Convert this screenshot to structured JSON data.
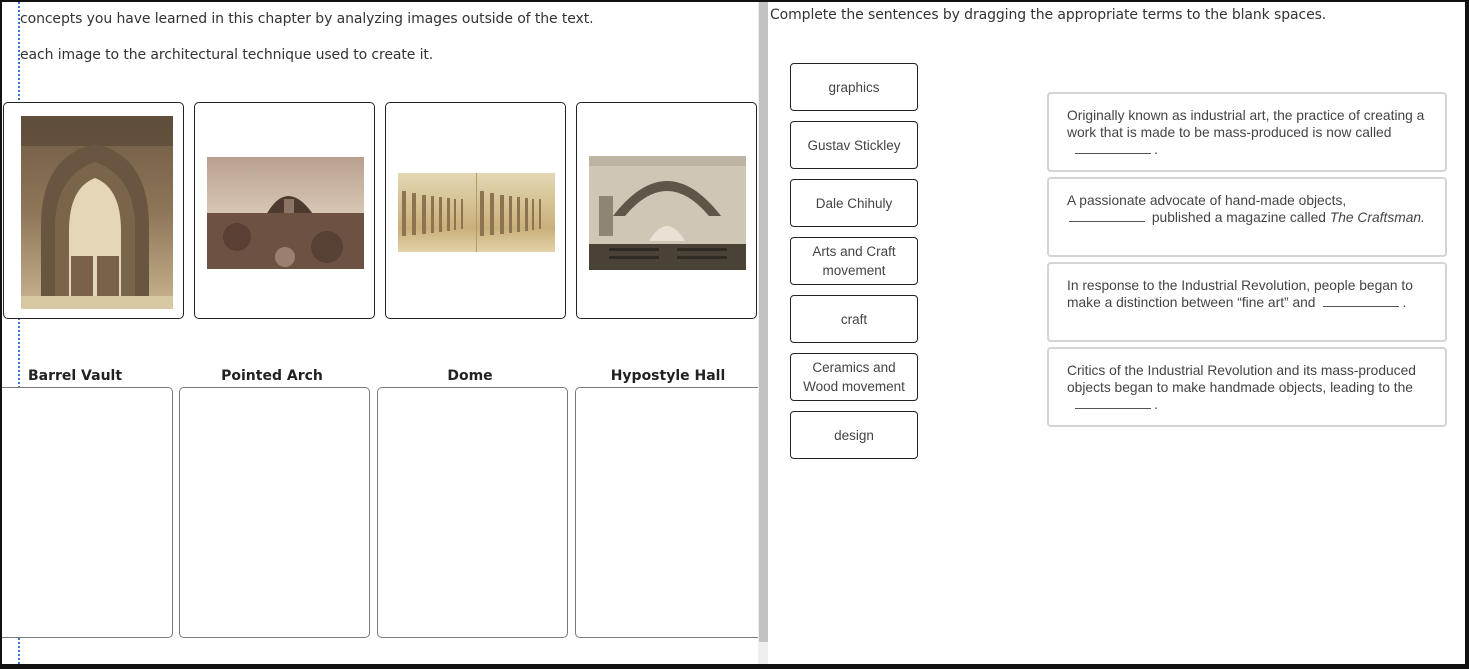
{
  "left": {
    "instructions": [
      "concepts you have learned in this chapter by analyzing images outside of the text.",
      "each image to the architectural technique used to create it."
    ],
    "images": [
      {
        "subject": "gothic-portal-photo",
        "description": "Sepia photo of a cathedral doorway with pointed arch"
      },
      {
        "subject": "stupa-dome-photo",
        "description": "Sepia photo of a domed stupa on a hill"
      },
      {
        "subject": "colonnade-photo",
        "description": "Stereograph of a long colonnaded hall"
      },
      {
        "subject": "vaulted-church-interior-photo",
        "description": "Sepia photo of a church interior with barrel vault"
      }
    ],
    "targets": [
      {
        "label": "Barrel Vault"
      },
      {
        "label": "Pointed Arch"
      },
      {
        "label": "Dome"
      },
      {
        "label": "Hypostyle Hall"
      }
    ]
  },
  "right": {
    "instruction": "Complete the sentences by dragging the appropriate terms to the blank spaces.",
    "terms": [
      "graphics",
      "Gustav Stickley",
      "Dale Chihuly",
      "Arts and Craft movement",
      "craft",
      "Ceramics and Wood movement",
      "design"
    ],
    "sentences": [
      {
        "before": "Originally known as industrial art, the practice of creating a work that is made to be mass-produced is now called",
        "after": ".",
        "italic": ""
      },
      {
        "before": "A passionate advocate of hand-made objects,",
        "after": "published a magazine called",
        "italic": "The Craftsman."
      },
      {
        "before": "In response to the Industrial Revolution, people began to make a distinction between “fine art” and",
        "after": ".",
        "italic": ""
      },
      {
        "before": "Critics of the Industrial Revolution and its mass-produced objects began to make handmade objects, leading to the",
        "after": ".",
        "italic": ""
      }
    ]
  },
  "colors": {
    "focus_outline": "#3a74c8",
    "card_border": "#222222",
    "dropzone_border": "#7a7a7a",
    "sentence_border": "#d4d4d4",
    "scrollbar_thumb": "#c2c2c2"
  }
}
